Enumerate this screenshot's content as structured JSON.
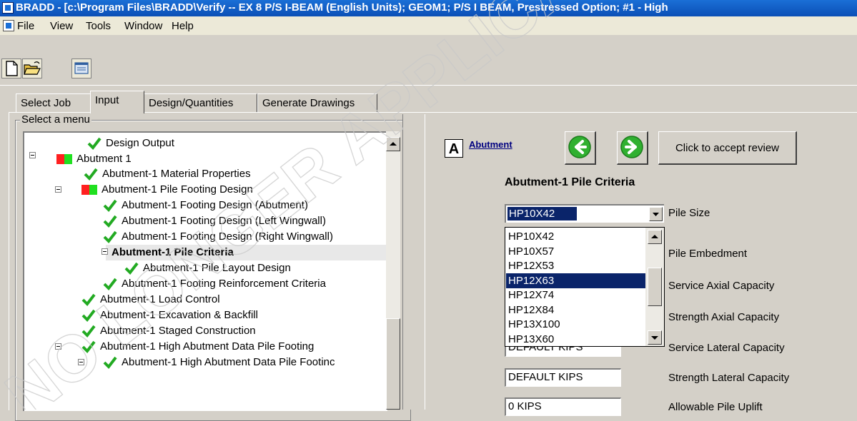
{
  "window": {
    "title": "BRADD - [c:\\Program Files\\BRADD\\Verify -- EX 8 P/S I-BEAM (English Units); GEOM1; P/S I BEAM, Prestressed Option; #1 - High"
  },
  "menu": {
    "items": [
      "File",
      "View",
      "Tools",
      "Window",
      "Help"
    ]
  },
  "tabs": {
    "items": [
      "Select Job",
      "Input",
      "Design/Quantities",
      "Generate Drawings"
    ],
    "active": "Input"
  },
  "left_panel": {
    "group_label": "Select a menu",
    "tree": [
      {
        "label": "Design Output",
        "state": "check"
      },
      {
        "label": "Abutment 1",
        "state": "red-green"
      },
      {
        "label": "Abutment-1 Material Properties",
        "state": "check"
      },
      {
        "label": "Abutment-1 Pile Footing Design",
        "state": "red-green"
      },
      {
        "label": "Abutment-1 Footing Design (Abutment)",
        "state": "check"
      },
      {
        "label": "Abutment-1 Footing Design (Left Wingwall)",
        "state": "check"
      },
      {
        "label": "Abutment-1 Footing Design (Right Wingwall)",
        "state": "check"
      },
      {
        "label": "Abutment-1 Pile Criteria",
        "state": "selected"
      },
      {
        "label": "Abutment-1 Pile Layout Design",
        "state": "check"
      },
      {
        "label": "Abutment-1 Footing Reinforcement Criteria",
        "state": "check"
      },
      {
        "label": "Abutment-1 Load Control",
        "state": "check"
      },
      {
        "label": "Abutment-1 Excavation & Backfill",
        "state": "check"
      },
      {
        "label": "Abutment-1 Staged Construction",
        "state": "check"
      },
      {
        "label": "Abutment-1 High Abutment Data Pile Footing",
        "state": "check"
      },
      {
        "label": "Abutment-1 High Abutment Data Pile Footinc",
        "state": "check"
      }
    ]
  },
  "right_panel": {
    "letter": "A",
    "link": "Abutment",
    "accept_button": "Click to accept review",
    "section_title": "Abutment-1 Pile Criteria",
    "pile_size": {
      "value": "HP10X42",
      "label": "Pile Size",
      "options": [
        "HP10X42",
        "HP10X57",
        "HP12X53",
        "HP12X63",
        "HP12X74",
        "HP12X84",
        "HP13X100",
        "HP13X60"
      ],
      "highlighted": "HP12X63"
    },
    "fields": [
      {
        "label": "Pile Embedment",
        "value": ""
      },
      {
        "label": "Service Axial Capacity",
        "value": ""
      },
      {
        "label": "Strength Axial Capacity",
        "value": ""
      },
      {
        "label": "Service Lateral Capacity",
        "value": "DEFAULT KIPS"
      },
      {
        "label": "Strength Lateral Capacity",
        "value": "DEFAULT KIPS"
      },
      {
        "label": "Allowable Pile Uplift",
        "value": "0 KIPS"
      }
    ]
  },
  "watermark": {
    "text": "NO LONGER APPLICABLE"
  },
  "colors": {
    "check_green": "#22aa22",
    "status_red": "#ff2020",
    "status_green": "#20e020",
    "selection_blue": "#0a246a"
  }
}
